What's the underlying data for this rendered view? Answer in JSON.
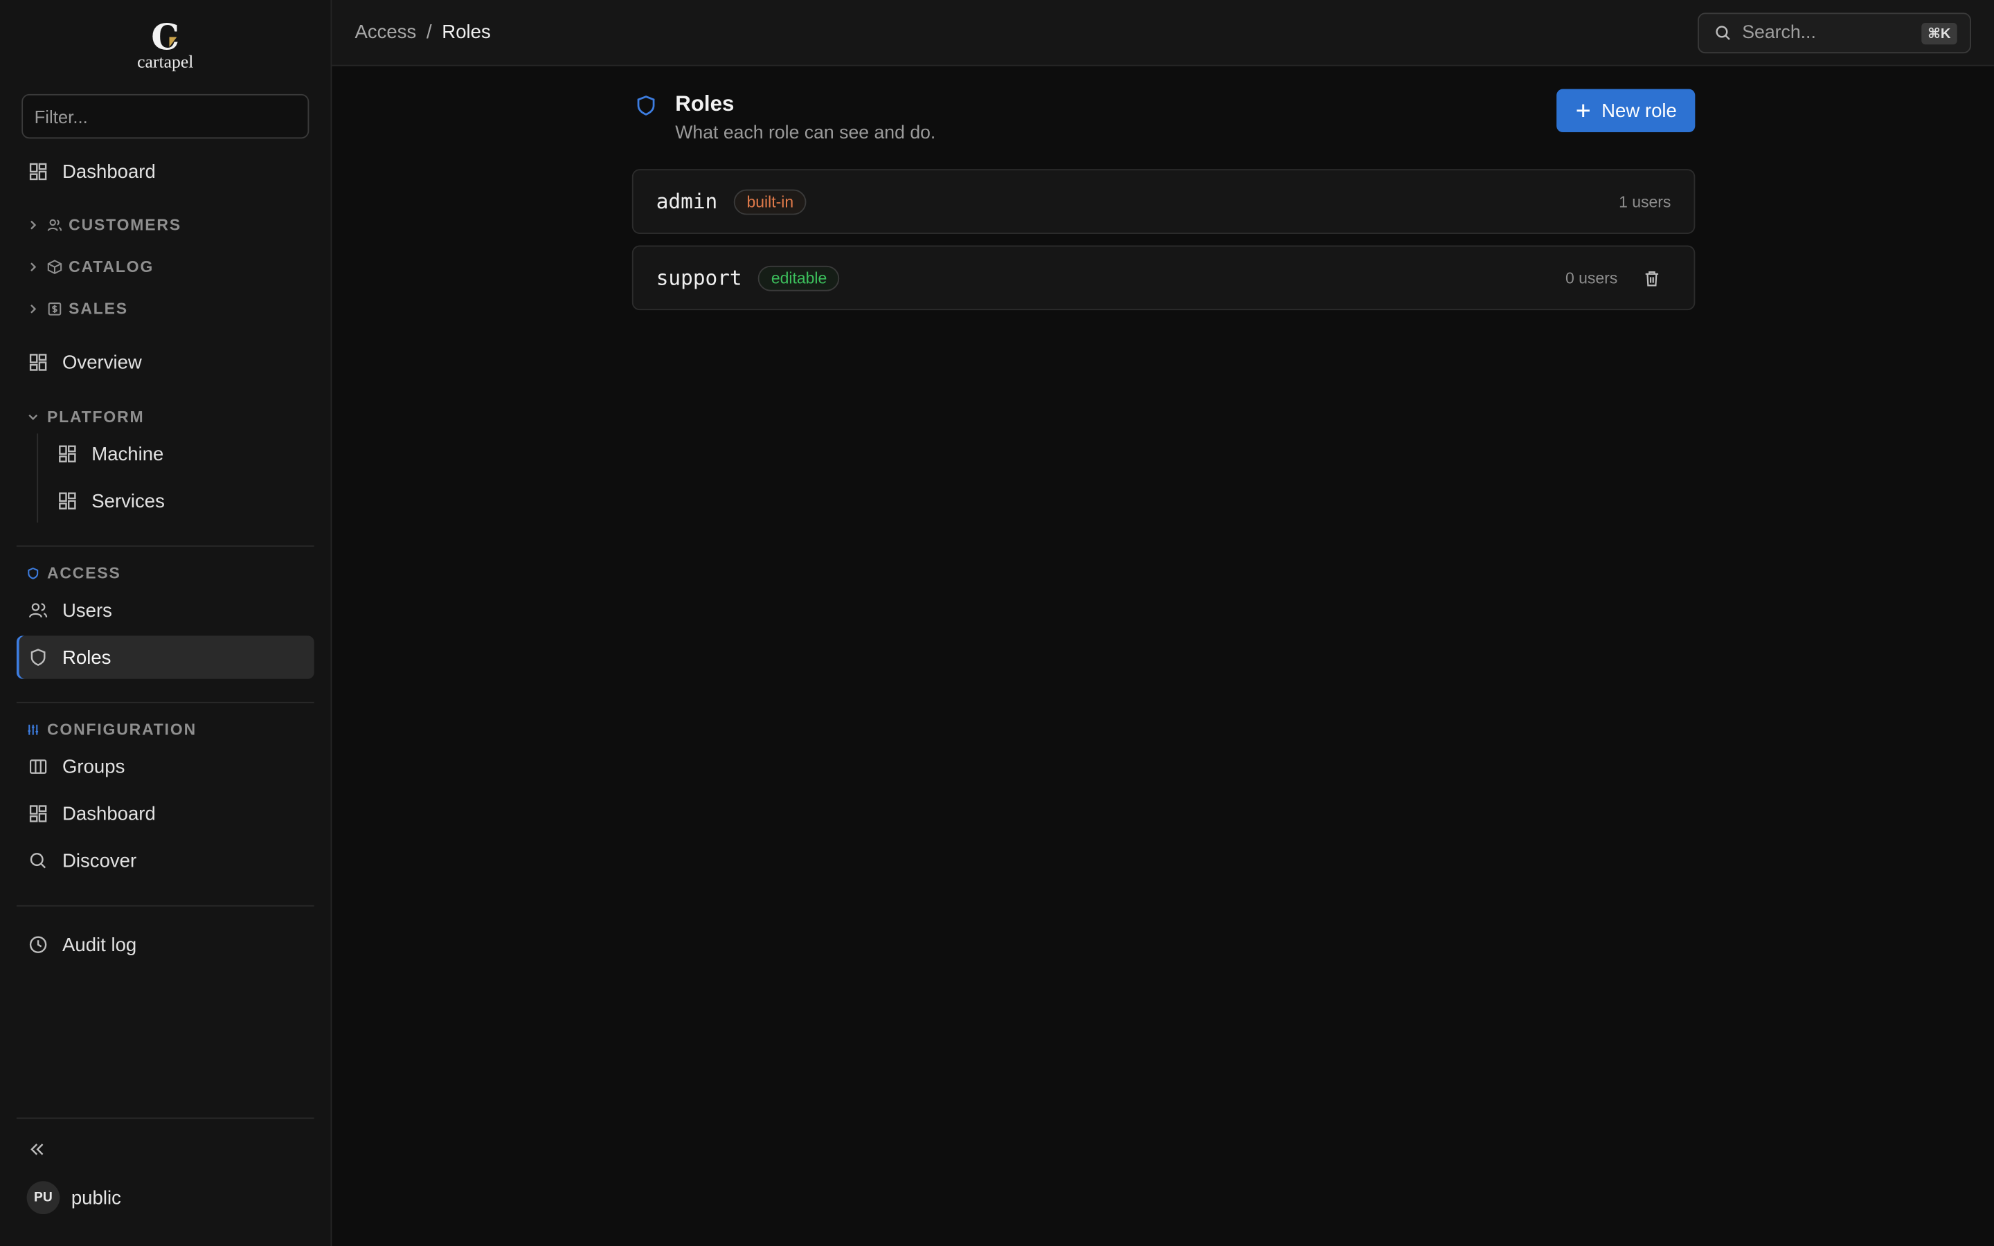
{
  "logo": {
    "mark": "C",
    "name": "cartapel"
  },
  "sidebar": {
    "filter_placeholder": "Filter...",
    "dashboard": "Dashboard",
    "sections": {
      "customers": "CUSTOMERS",
      "catalog": "CATALOG",
      "sales": "SALES",
      "platform": "PLATFORM",
      "access": "ACCESS",
      "configuration": "CONFIGURATION"
    },
    "overview": "Overview",
    "platform_items": [
      "Machine",
      "Services"
    ],
    "access_items": [
      "Users",
      "Roles"
    ],
    "configuration_items": [
      "Groups",
      "Dashboard",
      "Discover"
    ],
    "audit_log": "Audit log",
    "user": {
      "initials": "PU",
      "name": "public"
    }
  },
  "topbar": {
    "breadcrumb": {
      "parent": "Access",
      "separator": "/",
      "current": "Roles"
    },
    "search": {
      "placeholder": "Search...",
      "shortcut": "⌘K"
    }
  },
  "page": {
    "title": "Roles",
    "subtitle": "What each role can see and do.",
    "new_button": "New role"
  },
  "roles": [
    {
      "name": "admin",
      "badge": "built-in",
      "users": "1 users"
    },
    {
      "name": "support",
      "badge": "editable",
      "users": "0 users"
    }
  ],
  "colors": {
    "accent": "#2d72d2",
    "builtin_badge": "#e07a4a",
    "editable_badge": "#3cbf5c",
    "active_indicator": "#3d7de0"
  }
}
